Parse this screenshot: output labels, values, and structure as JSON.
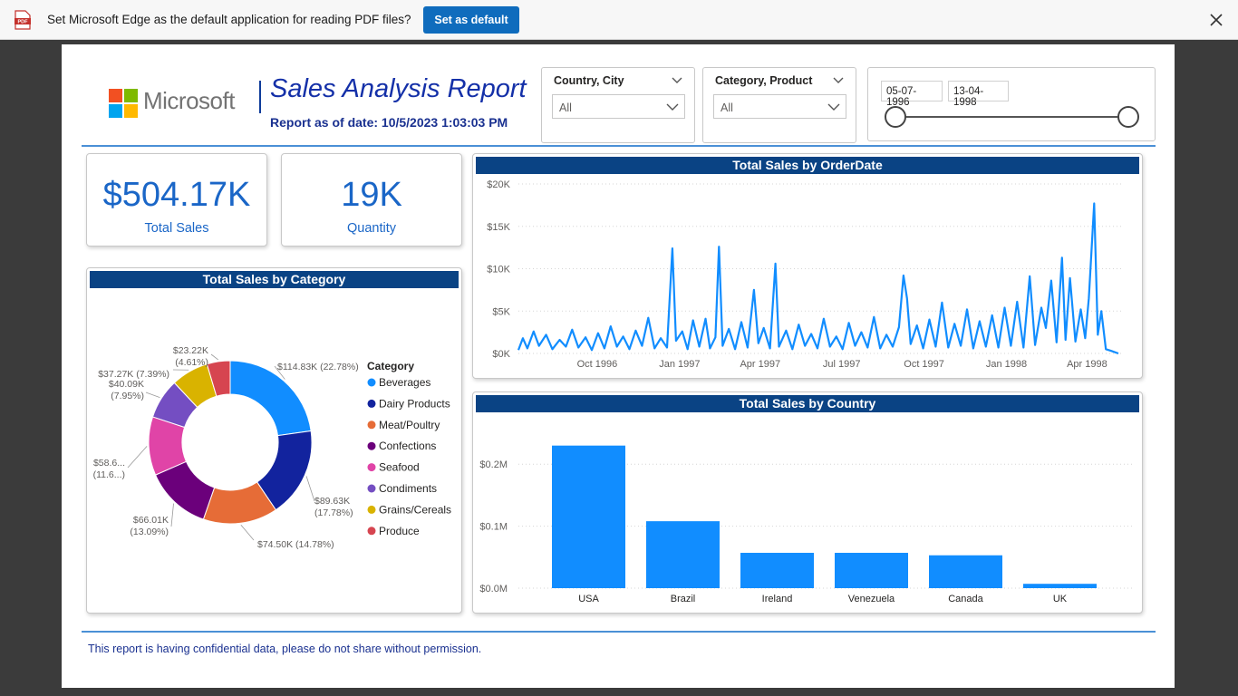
{
  "notification": {
    "icon_label": "PDF",
    "message": "Set Microsoft Edge as the default application for reading PDF files?",
    "button_label": "Set as default"
  },
  "header": {
    "logo_text": "Microsoft",
    "title": "Sales Analysis Report",
    "date_text": "Report as of date: 10/5/2023 1:03:03 PM"
  },
  "slicers": {
    "country_city": {
      "title": "Country, City",
      "value": "All"
    },
    "category_product": {
      "title": "Category, Product",
      "value": "All"
    },
    "date_range": {
      "start": "05-07-1996",
      "end": "13-04-1998"
    }
  },
  "kpis": {
    "total_sales": {
      "value": "$504.17K",
      "label": "Total Sales"
    },
    "quantity": {
      "value": "19K",
      "label": "Quantity"
    }
  },
  "colors": {
    "accent_blue": "#118dff",
    "header_navy": "#0a4384",
    "title_blue": "#1430a8"
  },
  "footer_text": "This report is having confidential data, please do not share without permission.",
  "chart_data": [
    {
      "type": "line",
      "title": "Total Sales by OrderDate",
      "yticks": [
        "$20K",
        "$15K",
        "$10K",
        "$5K",
        "$0K"
      ],
      "ytick_values": [
        20000,
        15000,
        10000,
        5000,
        0
      ],
      "xticks": [
        "Oct 1996",
        "Jan 1997",
        "Apr 1997",
        "Jul 1997",
        "Oct 1997",
        "Jan 1998",
        "Apr 1998"
      ],
      "x_range": [
        "1996-07-05",
        "1998-05-06"
      ],
      "ylim": [
        0,
        20000
      ],
      "grid": true,
      "series": [
        {
          "color": "#118dff",
          "points": [
            [
              "1996-07-05",
              400
            ],
            [
              "1996-07-10",
              1800
            ],
            [
              "1996-07-15",
              600
            ],
            [
              "1996-07-22",
              2600
            ],
            [
              "1996-07-28",
              900
            ],
            [
              "1996-08-05",
              2200
            ],
            [
              "1996-08-12",
              500
            ],
            [
              "1996-08-20",
              1600
            ],
            [
              "1996-08-27",
              800
            ],
            [
              "1996-09-03",
              2800
            ],
            [
              "1996-09-10",
              700
            ],
            [
              "1996-09-18",
              1900
            ],
            [
              "1996-09-25",
              400
            ],
            [
              "1996-10-02",
              2400
            ],
            [
              "1996-10-09",
              600
            ],
            [
              "1996-10-16",
              3200
            ],
            [
              "1996-10-23",
              800
            ],
            [
              "1996-10-30",
              2000
            ],
            [
              "1996-11-06",
              500
            ],
            [
              "1996-11-13",
              2700
            ],
            [
              "1996-11-20",
              900
            ],
            [
              "1996-11-27",
              4200
            ],
            [
              "1996-12-04",
              600
            ],
            [
              "1996-12-11",
              1800
            ],
            [
              "1996-12-18",
              700
            ],
            [
              "1996-12-24",
              12400
            ],
            [
              "1996-12-28",
              1500
            ],
            [
              "1997-01-04",
              2600
            ],
            [
              "1997-01-10",
              500
            ],
            [
              "1997-01-16",
              3900
            ],
            [
              "1997-01-23",
              800
            ],
            [
              "1997-01-30",
              4100
            ],
            [
              "1997-02-04",
              600
            ],
            [
              "1997-02-10",
              1900
            ],
            [
              "1997-02-14",
              12600
            ],
            [
              "1997-02-18",
              900
            ],
            [
              "1997-02-25",
              2900
            ],
            [
              "1997-03-04",
              500
            ],
            [
              "1997-03-11",
              3700
            ],
            [
              "1997-03-18",
              700
            ],
            [
              "1997-03-25",
              7500
            ],
            [
              "1997-03-30",
              1200
            ],
            [
              "1997-04-05",
              3000
            ],
            [
              "1997-04-12",
              600
            ],
            [
              "1997-04-18",
              10600
            ],
            [
              "1997-04-22",
              800
            ],
            [
              "1997-04-30",
              2700
            ],
            [
              "1997-05-07",
              500
            ],
            [
              "1997-05-14",
              3400
            ],
            [
              "1997-05-21",
              900
            ],
            [
              "1997-05-28",
              2300
            ],
            [
              "1997-06-04",
              600
            ],
            [
              "1997-06-11",
              4100
            ],
            [
              "1997-06-18",
              800
            ],
            [
              "1997-06-25",
              2000
            ],
            [
              "1997-07-02",
              500
            ],
            [
              "1997-07-09",
              3600
            ],
            [
              "1997-07-16",
              900
            ],
            [
              "1997-07-23",
              2500
            ],
            [
              "1997-07-30",
              700
            ],
            [
              "1997-08-06",
              4300
            ],
            [
              "1997-08-13",
              600
            ],
            [
              "1997-08-20",
              2200
            ],
            [
              "1997-08-27",
              800
            ],
            [
              "1997-09-03",
              3100
            ],
            [
              "1997-09-08",
              9200
            ],
            [
              "1997-09-12",
              6500
            ],
            [
              "1997-09-16",
              1100
            ],
            [
              "1997-09-23",
              3300
            ],
            [
              "1997-09-30",
              600
            ],
            [
              "1997-10-07",
              4000
            ],
            [
              "1997-10-14",
              800
            ],
            [
              "1997-10-21",
              6000
            ],
            [
              "1997-10-28",
              700
            ],
            [
              "1997-11-04",
              3500
            ],
            [
              "1997-11-11",
              900
            ],
            [
              "1997-11-18",
              5200
            ],
            [
              "1997-11-25",
              600
            ],
            [
              "1997-12-02",
              3800
            ],
            [
              "1997-12-09",
              800
            ],
            [
              "1997-12-16",
              4500
            ],
            [
              "1997-12-23",
              700
            ],
            [
              "1997-12-30",
              5400
            ],
            [
              "1998-01-06",
              900
            ],
            [
              "1998-01-13",
              6100
            ],
            [
              "1998-01-20",
              700
            ],
            [
              "1998-01-27",
              9100
            ],
            [
              "1998-02-02",
              1000
            ],
            [
              "1998-02-09",
              5400
            ],
            [
              "1998-02-14",
              3000
            ],
            [
              "1998-02-20",
              8600
            ],
            [
              "1998-02-26",
              1300
            ],
            [
              "1998-03-04",
              11300
            ],
            [
              "1998-03-08",
              1600
            ],
            [
              "1998-03-13",
              8900
            ],
            [
              "1998-03-19",
              1400
            ],
            [
              "1998-03-25",
              5200
            ],
            [
              "1998-03-30",
              1800
            ],
            [
              "1998-04-03",
              6500
            ],
            [
              "1998-04-09",
              17700
            ],
            [
              "1998-04-13",
              2200
            ],
            [
              "1998-04-17",
              5000
            ],
            [
              "1998-04-22",
              500
            ],
            [
              "1998-04-28",
              300
            ],
            [
              "1998-05-06",
              0
            ]
          ]
        }
      ]
    },
    {
      "type": "pie",
      "title": "Total Sales by Category",
      "legend_title": "Category",
      "legend_position": "right",
      "slices": [
        {
          "category": "Beverages",
          "value": 114.83,
          "label": "$114.83K (22.78%)",
          "color": "#118dff"
        },
        {
          "category": "Dairy Products",
          "value": 89.63,
          "label_line1": "$89.63K",
          "label_line2": "(17.78%)",
          "color": "#12239e"
        },
        {
          "category": "Meat/Poultry",
          "value": 74.5,
          "label": "$74.50K (14.78%)",
          "color": "#e66c37"
        },
        {
          "category": "Confections",
          "value": 66.01,
          "label_line1": "$66.01K",
          "label_line2": "(13.09%)",
          "color": "#6b007b"
        },
        {
          "category": "Seafood",
          "value": 58.6,
          "label_line1": "$58.6...",
          "label_line2": "(11.6...)",
          "color": "#e044a7"
        },
        {
          "category": "Condiments",
          "value": 40.09,
          "label_line1": "$40.09K",
          "label_line2": "(7.95%)",
          "color": "#744ec2"
        },
        {
          "category": "Grains/Cereals",
          "value": 37.27,
          "label": "$37.27K (7.39%)",
          "color": "#d9b300"
        },
        {
          "category": "Produce",
          "value": 23.22,
          "label_line1": "$23.22K",
          "label_line2": "(4.61%)",
          "color": "#d64550"
        }
      ]
    },
    {
      "type": "bar",
      "title": "Total Sales by Country",
      "categories": [
        "USA",
        "Brazil",
        "Ireland",
        "Venezuela",
        "Canada",
        "UK"
      ],
      "values": [
        0.23,
        0.108,
        0.057,
        0.057,
        0.053,
        0.007
      ],
      "yticks": [
        "$0.2M",
        "$0.1M",
        "$0.0M"
      ],
      "ytick_values": [
        0.2,
        0.1,
        0.0
      ],
      "ylim": [
        0,
        0.25
      ],
      "unit": "M",
      "color": "#118dff",
      "grid": true
    }
  ]
}
